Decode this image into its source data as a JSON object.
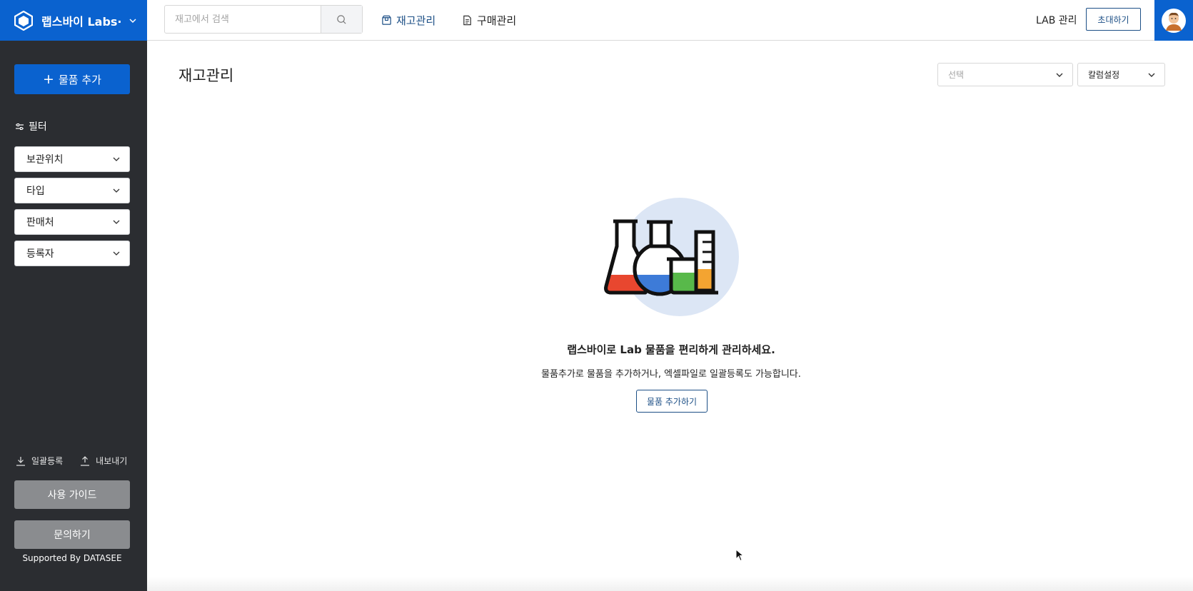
{
  "brand": {
    "name": "랩스바이 Labs···",
    "logo_icon": "hexagon-logo-icon",
    "color": "#0a62cf"
  },
  "search": {
    "placeholder": "재고에서 검색",
    "icon": "search-icon"
  },
  "nav": {
    "tabs": [
      {
        "label": "재고관리",
        "icon": "box-icon",
        "active": true
      },
      {
        "label": "구매관리",
        "icon": "document-icon",
        "active": false
      }
    ]
  },
  "header": {
    "lab_manage": "LAB 관리",
    "invite": "초대하기",
    "avatar_icon": "user-avatar-icon"
  },
  "sidebar": {
    "add_button": "물품 추가",
    "filter_title": "필터",
    "filters": [
      "보관위치",
      "타입",
      "판매처",
      "등록자"
    ],
    "bulk_register": "일괄등록",
    "export": "내보내기",
    "guide_button": "사용 가이드",
    "inquiry_button": "문의하기",
    "supported_by": "Supported By DATASEE",
    "background": "#2b2d31"
  },
  "main": {
    "title": "재고관리",
    "select_placeholder": "선택",
    "column_settings": "칼럼설정",
    "empty": {
      "title": "랩스바이로 Lab 물품을 편리하게 관리하세요.",
      "subtitle": "물품추가로 물품을 추가하거나, 엑셀파일로 일괄등록도 가능합니다.",
      "button": "물품 추가하기",
      "illustration": "lab-flasks-illustration"
    }
  },
  "colors": {
    "accent": "#0a62cf",
    "link": "#1c4f86",
    "gray_button": "#8a8c8f"
  }
}
